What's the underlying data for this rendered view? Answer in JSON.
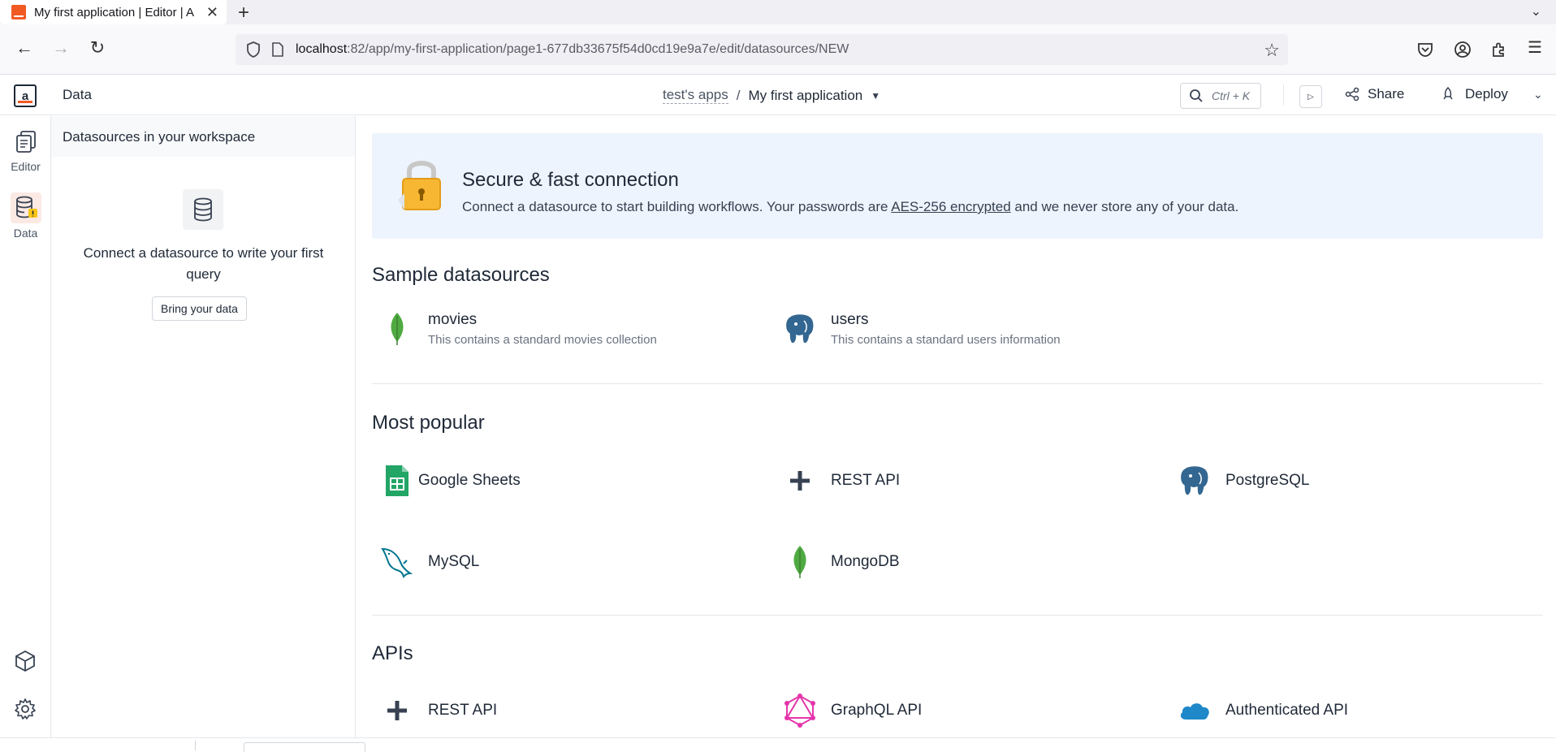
{
  "browser": {
    "tab_title": "My first application | Editor | A",
    "url_host": "localhost",
    "url_path": ":82/app/my-first-application/page1-677db33675f54d0cd19e9a7e/edit/datasources/NEW"
  },
  "header": {
    "section": "Data",
    "workspace": "test's apps",
    "separator": "/",
    "app_name": "My first application",
    "search_shortcut": "Ctrl + K",
    "share_label": "Share",
    "deploy_label": "Deploy"
  },
  "rail": {
    "editor_label": "Editor",
    "data_label": "Data"
  },
  "workspace_panel": {
    "title": "Datasources in your workspace",
    "empty_text": "Connect a datasource to write your first query",
    "bring_button": "Bring your data"
  },
  "banner": {
    "title": "Secure & fast connection",
    "desc_before": "Connect a datasource to start building workflows. Your passwords are ",
    "desc_link": "AES-256 encrypted",
    "desc_after": " and we never store any of your data."
  },
  "sample": {
    "title": "Sample datasources",
    "items": [
      {
        "name": "movies",
        "desc": "This contains a standard movies collection",
        "icon": "mongodb-leaf-icon"
      },
      {
        "name": "users",
        "desc": "This contains a standard users information",
        "icon": "postgresql-elephant-icon"
      }
    ]
  },
  "popular": {
    "title": "Most popular",
    "items": [
      {
        "name": "Google Sheets",
        "icon": "google-sheets-icon"
      },
      {
        "name": "REST API",
        "icon": "plus-icon"
      },
      {
        "name": "PostgreSQL",
        "icon": "postgresql-elephant-icon"
      },
      {
        "name": "MySQL",
        "icon": "mysql-dolphin-icon"
      },
      {
        "name": "MongoDB",
        "icon": "mongodb-leaf-icon"
      }
    ]
  },
  "apis": {
    "title": "APIs",
    "items": [
      {
        "name": "REST API",
        "icon": "plus-icon"
      },
      {
        "name": "GraphQL API",
        "icon": "graphql-icon"
      },
      {
        "name": "Authenticated API",
        "icon": "cloud-icon"
      }
    ]
  },
  "colors": {
    "accent": "#f25a24",
    "banner_bg": "#eef4fd",
    "mongodb": "#4faa41",
    "sheets": "#23a566",
    "graphql": "#e535ab",
    "cloud": "#1e88c9",
    "postgres": "#336791"
  }
}
